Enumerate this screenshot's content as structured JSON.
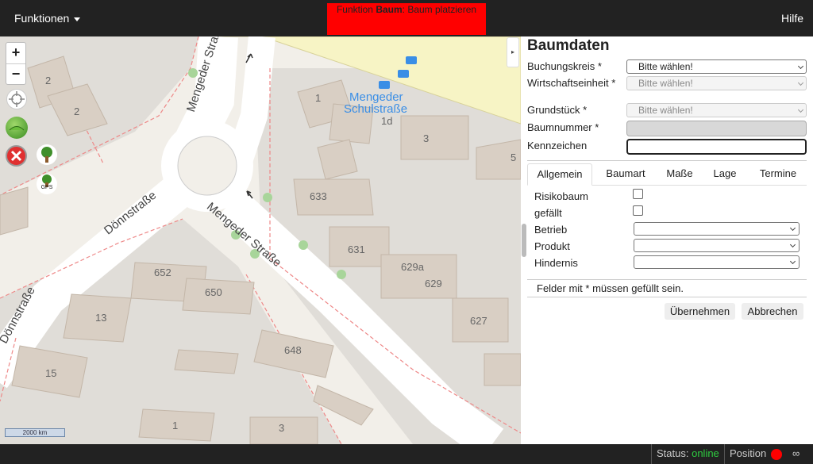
{
  "topbar": {
    "menu_label": "Funktionen",
    "banner_prefix": "Funktion ",
    "banner_function": "Baum",
    "banner_suffix": ": Baum platzieren",
    "help_label": "Hilfe",
    "banner_color": "#ff0000"
  },
  "map": {
    "zoom_in": "+",
    "zoom_out": "−",
    "scale_label": "2000 km",
    "tool_icons": [
      "crosshair-icon",
      "layers-icon",
      "delete-icon",
      "tree-icon",
      "tree-gps-icon"
    ],
    "gps_label": "GPS",
    "streets": [
      "Mengeder Straße",
      "Mengeder Straße",
      "Dönnstraße",
      "Dönnstraße"
    ],
    "places": [
      "Mengeder",
      "Schulstraße"
    ],
    "house_numbers": [
      "2",
      "2",
      "1",
      "1d",
      "3",
      "5",
      "633",
      "631",
      "629a",
      "629",
      "652",
      "650",
      "627",
      "13",
      "648",
      "15",
      "1",
      "3"
    ]
  },
  "panel": {
    "title": "Baumdaten",
    "fields": [
      {
        "label": "Buchungskreis *",
        "value": "Bitte wählen!",
        "disabled": false
      },
      {
        "label": "Wirtschaftseinheit *",
        "value": "Bitte wählen!",
        "disabled": true
      },
      {
        "label": "Grundstück *",
        "value": "Bitte wählen!",
        "disabled": true
      },
      {
        "label": "Baumnummer *",
        "value": "",
        "disabled": true
      },
      {
        "label": "Kennzeichen",
        "value": "",
        "disabled": false
      }
    ],
    "tabs": [
      "Allgemein",
      "Baumart",
      "Maße",
      "Lage",
      "Termine"
    ],
    "active_tab": "Allgemein",
    "general": {
      "risikobaum": "Risikobaum",
      "gefaellt": "gefällt",
      "betrieb": "Betrieb",
      "produkt": "Produkt",
      "hindernis": "Hindernis"
    },
    "note": "Felder mit * müssen gefüllt sein.",
    "apply_label": "Übernehmen",
    "cancel_label": "Abbrechen"
  },
  "status": {
    "status_label": "Status:",
    "status_value": "online",
    "position_label": "Position",
    "position_color": "#ff0000",
    "infinity": "∞"
  }
}
